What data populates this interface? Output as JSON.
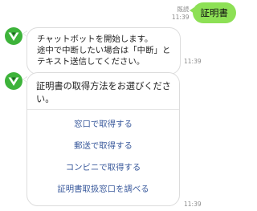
{
  "conversation": {
    "outgoing": {
      "read_label": "既読",
      "time": "11:39",
      "text": "証明書"
    },
    "incoming": [
      {
        "lines": [
          "チャットボットを開始します。",
          "途中で中断したい場合は「中断」と",
          "テキスト送信してください。"
        ],
        "time": "11:39"
      },
      {
        "question": "証明書の取得方法をお選びください。",
        "options": [
          "窓口で取得する",
          "郵送で取得する",
          "コンビニで取得する",
          "証明書取扱窓口を調べる"
        ],
        "time": "11:39"
      }
    ]
  },
  "avatar": {
    "icon": "bot-avatar-icon",
    "green": "#3db33a",
    "dark": "#1f5d27"
  },
  "colors": {
    "outgoing_bubble": "#8de055",
    "option_link": "#3a5a9c",
    "timestamp": "#8b8b8b",
    "bubble_border": "#dcdcdc"
  }
}
